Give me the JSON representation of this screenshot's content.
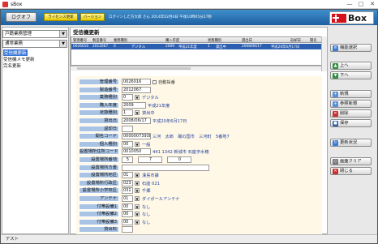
{
  "window": {
    "title": "sBox",
    "buttons": [
      "—",
      "□",
      "✕"
    ]
  },
  "topbar": {
    "logout": "ログオフ",
    "license": "ライセンス更新",
    "version": "バージョン",
    "login_msg": "ログインした方大郎 さん  2014年02月4日 午後10時05分27秒"
  },
  "logo": {
    "text": "Box"
  },
  "nav": {
    "system_select": "戸籍業務管理",
    "group_select": "通常業務",
    "items": [
      "受信機更新",
      "受信機メモ更新",
      "完名更新"
    ],
    "selected": 0
  },
  "section": {
    "title": "受信機更新"
  },
  "grid": {
    "headers": [
      "管理番号",
      "製造番号",
      "業務種別",
      "購入年度",
      "状態種別",
      "貸出日",
      "返却日",
      "開名"
    ],
    "row": [
      "0026016",
      "2012067",
      "0",
      "デジタル",
      "2009",
      "平成21年度",
      "1",
      "貸出中",
      "2008/06/17",
      "平成20年6月17日"
    ]
  },
  "form": {
    "rows": [
      {
        "label": "管理番号",
        "value": "0026016",
        "extra": "自動採番",
        "has_check": true
      },
      {
        "label": "製造番号",
        "value": "2012067"
      },
      {
        "label": "業務種別",
        "value": "0",
        "desc": "デジタル"
      },
      {
        "label": "購入年度",
        "value": "2009",
        "desc": "平成21年度"
      },
      {
        "label": "状態種別",
        "value": "1",
        "desc": "貸出中"
      },
      {
        "label": "貸出日",
        "value": "2008/06/17",
        "desc": "平成20年6月17日"
      },
      {
        "label": "返却日",
        "value": ""
      },
      {
        "label": "開名コード",
        "value": "00000073938",
        "desc": "三河　太郎　磯の国市　三河町　5番地7"
      },
      {
        "label": "個人種別",
        "value": "00",
        "desc": "一般"
      },
      {
        "label": "設置場所住所コード",
        "value": "0010050",
        "desc": "441 1342 新城市 石座字水穂"
      },
      {
        "label": "設置場所番地",
        "value": "5",
        "value2": "7",
        "value3": "0"
      },
      {
        "label": "設置場所方書",
        "value": ""
      },
      {
        "label": "設置場所地区",
        "value": "01",
        "desc": "漢島市誰"
      },
      {
        "label": "設置場所行政区",
        "value": "023",
        "desc": "石座 021"
      },
      {
        "label": "設置場所小学校区",
        "value": "031",
        "desc": "千郷"
      },
      {
        "label": "アンテナ",
        "value": "01",
        "desc": "ダイポールアンテナ"
      },
      {
        "label": "付帯設備1",
        "value": "00",
        "desc": "なし"
      },
      {
        "label": "付帯設備2",
        "value": "00",
        "desc": "なし"
      },
      {
        "label": "付帯設備3",
        "value": "00",
        "desc": "なし"
      },
      {
        "label": "貸出料",
        "value": ""
      }
    ]
  },
  "actions": {
    "func_select": "機能選択",
    "up": "上へ",
    "down": "下へ",
    "new": "新規",
    "ref_new": "参照新規",
    "delete": "削除",
    "save": "保存",
    "refresh": "更新状況",
    "clear": "画面クリア",
    "close": "閉じる"
  },
  "status": {
    "text": "テスト"
  },
  "colors": {
    "topbar": "#2a70b8",
    "selected_row": "#2d5fb1",
    "label_bg": "#a9c3e4",
    "form_bg": "#fff8e6",
    "desc_text": "#1f3f9f"
  }
}
